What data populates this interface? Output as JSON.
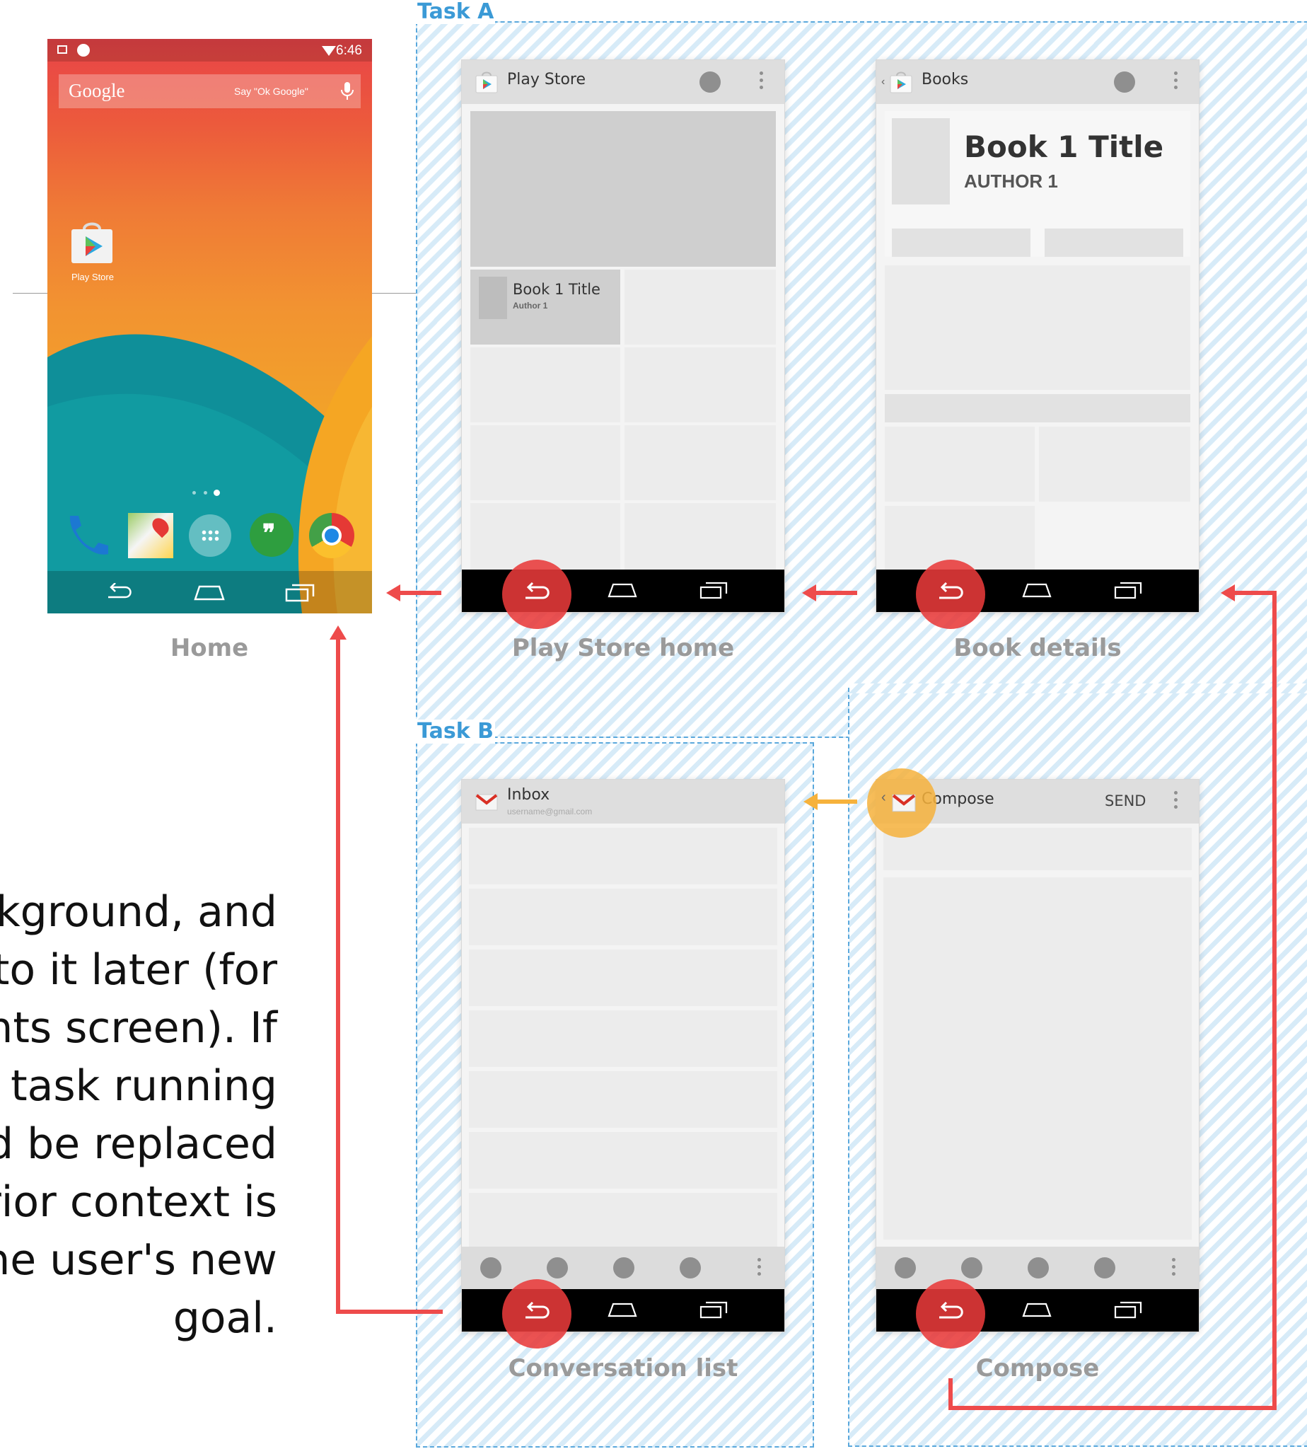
{
  "tasks": {
    "task_a": "Task A",
    "task_b": "Task B"
  },
  "home_screen": {
    "caption": "Home",
    "status_time": "6:46",
    "search_brand": "Google",
    "search_hint": "Say \"Ok Google\"",
    "app_label": "Play Store",
    "dock_icons": [
      "phone-icon",
      "maps-icon",
      "app-drawer-icon",
      "hangouts-icon",
      "chrome-icon"
    ]
  },
  "play_store_home": {
    "caption": "Play Store home",
    "title": "Play Store",
    "featured_book_title": "Book 1 Title",
    "featured_book_author": "Author 1"
  },
  "book_details": {
    "caption": "Book details",
    "title": "Books",
    "book_title": "Book 1 Title",
    "book_author": "AUTHOR 1"
  },
  "conversation_list": {
    "caption": "Conversation list",
    "title": "Inbox",
    "account": "username@gmail.com"
  },
  "compose": {
    "caption": "Compose",
    "title": "Compose",
    "send": "SEND"
  },
  "side_text": [
    "kground, and",
    "n to it later (for",
    "ents screen). If",
    "n task running",
    "d be replaced",
    "rior context is",
    "he user's new",
    "goal."
  ],
  "colors": {
    "back_arrow": "#ee4b4b",
    "up_arrow": "#f6b23c",
    "task_border": "#5aa8dc",
    "task_label": "#3b9ad6"
  }
}
